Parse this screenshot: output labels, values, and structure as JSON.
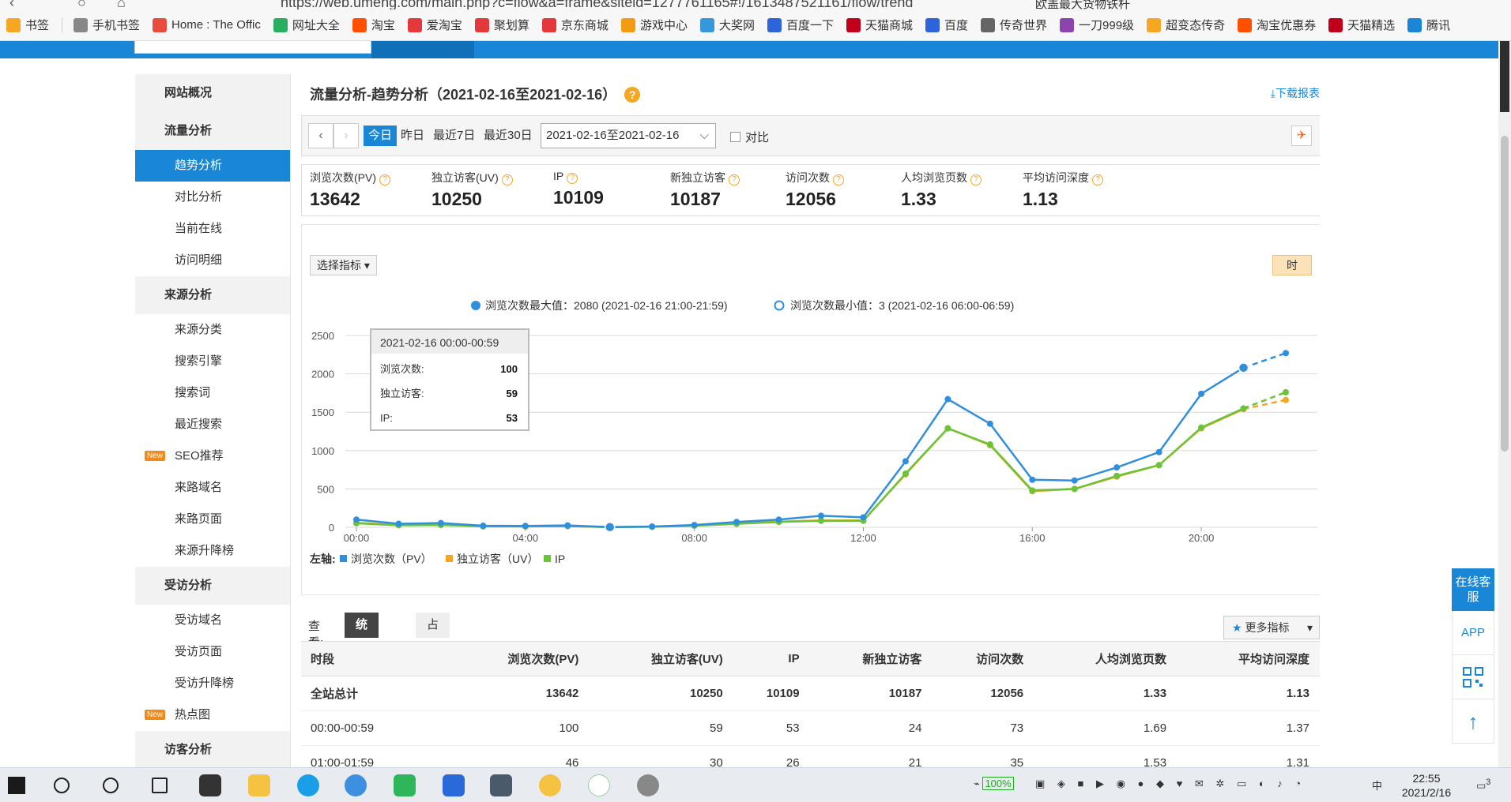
{
  "browser": {
    "url": "https://web.umeng.com/main.php?c=flow&a=frame&siteid=1277761165#!/1613487521161/flow/trend",
    "tab_title": "欧盖最大货物铁杆",
    "bookmarks": [
      {
        "label": "书签",
        "icon": "star-icon",
        "color": "#f5a623"
      },
      {
        "label": "手机书签",
        "icon": "phone-icon",
        "color": "#888888"
      },
      {
        "label": "Home : The Offic",
        "icon": "windows-icon",
        "color": "#e74c3c"
      },
      {
        "label": "网址大全",
        "icon": "hao-icon",
        "color": "#27ae60"
      },
      {
        "label": "淘宝",
        "icon": "taobao-icon",
        "color": "#ff5000"
      },
      {
        "label": "爱淘宝",
        "icon": "aitaobao-icon",
        "color": "#e4393c"
      },
      {
        "label": "聚划算",
        "icon": "juhuasuan-icon",
        "color": "#e4393c"
      },
      {
        "label": "京东商城",
        "icon": "jd-icon",
        "color": "#e4393c"
      },
      {
        "label": "游戏中心",
        "icon": "game-icon",
        "color": "#f39c12"
      },
      {
        "label": "大奖网",
        "icon": "award-icon",
        "color": "#3498db"
      },
      {
        "label": "百度一下",
        "icon": "baidu-icon",
        "color": "#2e64d9"
      },
      {
        "label": "天猫商城",
        "icon": "tmall-icon",
        "color": "#c0001a"
      },
      {
        "label": "百度",
        "icon": "baidu-icon",
        "color": "#2e64d9"
      },
      {
        "label": "传奇世界",
        "icon": "globe-icon",
        "color": "#666666"
      },
      {
        "label": "一刀999级",
        "icon": "game-icon",
        "color": "#8e44ad"
      },
      {
        "label": "超变态传奇",
        "icon": "smile-icon",
        "color": "#f5a623"
      },
      {
        "label": "淘宝优惠券",
        "icon": "taobao-icon",
        "color": "#ff5000"
      },
      {
        "label": "天猫精选",
        "icon": "tmall-icon",
        "color": "#c0001a"
      },
      {
        "label": "腾讯",
        "icon": "video-icon",
        "color": "#1a86d6"
      }
    ]
  },
  "sidebar": [
    {
      "type": "head",
      "label": "网站概况"
    },
    {
      "type": "head",
      "label": "流量分析"
    },
    {
      "type": "item",
      "label": "趋势分析",
      "active": true
    },
    {
      "type": "item",
      "label": "对比分析"
    },
    {
      "type": "item",
      "label": "当前在线"
    },
    {
      "type": "item",
      "label": "访问明细"
    },
    {
      "type": "head",
      "label": "来源分析"
    },
    {
      "type": "item",
      "label": "来源分类"
    },
    {
      "type": "item",
      "label": "搜索引擎"
    },
    {
      "type": "item",
      "label": "搜索词"
    },
    {
      "type": "item",
      "label": "最近搜索"
    },
    {
      "type": "item",
      "label": "SEO推荐",
      "badge": "New"
    },
    {
      "type": "item",
      "label": "来路域名"
    },
    {
      "type": "item",
      "label": "来路页面"
    },
    {
      "type": "item",
      "label": "来源升降榜"
    },
    {
      "type": "head",
      "label": "受访分析"
    },
    {
      "type": "item",
      "label": "受访域名"
    },
    {
      "type": "item",
      "label": "受访页面"
    },
    {
      "type": "item",
      "label": "受访升降榜"
    },
    {
      "type": "item",
      "label": "热点图",
      "badge": "New"
    },
    {
      "type": "head",
      "label": "访客分析"
    }
  ],
  "main": {
    "title": "流量分析-趋势分析（2021-02-16至2021-02-16）",
    "help": "?",
    "download": "下载报表",
    "filters": {
      "prev": "‹",
      "next": "›",
      "today": "今日",
      "yesterday": "昨日",
      "last7": "最近7日",
      "last30": "最近30日",
      "daterange": "2021-02-16至2021-02-16",
      "compare": "对比"
    },
    "metrics": [
      {
        "label": "浏览次数(PV)",
        "value": "13642"
      },
      {
        "label": "独立访客(UV)",
        "value": "10250"
      },
      {
        "label": "IP",
        "value": "10109"
      },
      {
        "label": "新独立访客",
        "value": "10187"
      },
      {
        "label": "访问次数",
        "value": "12056"
      },
      {
        "label": "人均浏览页数",
        "value": "1.33"
      },
      {
        "label": "平均访问深度",
        "value": "1.13"
      }
    ],
    "select_metric": "选择指标",
    "hour_button": "时",
    "view_label": "查看:",
    "view_tabs": [
      "统计报表",
      "占比"
    ],
    "more_metrics": "更多指标"
  },
  "chart_data": {
    "type": "line",
    "x": [
      "00:00",
      "01:00",
      "02:00",
      "03:00",
      "04:00",
      "05:00",
      "06:00",
      "07:00",
      "08:00",
      "09:00",
      "10:00",
      "11:00",
      "12:00",
      "13:00",
      "14:00",
      "15:00",
      "16:00",
      "17:00",
      "18:00",
      "19:00",
      "20:00",
      "21:00",
      "22:00"
    ],
    "xticks": [
      "00:00",
      "04:00",
      "08:00",
      "12:00",
      "16:00",
      "20:00"
    ],
    "ylim": [
      0,
      2500
    ],
    "yticks": [
      0,
      500,
      1000,
      1500,
      2000,
      2500
    ],
    "grid": true,
    "series": [
      {
        "name": "浏览次数（PV）",
        "color": "#2f8fdc",
        "values": [
          100,
          46,
          55,
          20,
          18,
          25,
          3,
          10,
          30,
          70,
          100,
          150,
          130,
          860,
          1670,
          1350,
          620,
          610,
          780,
          980,
          1740,
          2080,
          2270
        ],
        "dashed_from": 21
      },
      {
        "name": "独立访客（UV）",
        "color": "#f5a623",
        "values": [
          59,
          30,
          35,
          14,
          12,
          16,
          2,
          8,
          22,
          50,
          75,
          90,
          90,
          690,
          1290,
          1070,
          470,
          500,
          660,
          810,
          1290,
          1540,
          1660
        ],
        "dashed_from": 21
      },
      {
        "name": "IP",
        "color": "#6ac33a",
        "values": [
          53,
          26,
          30,
          12,
          11,
          15,
          2,
          7,
          20,
          45,
          70,
          85,
          85,
          700,
          1290,
          1080,
          480,
          500,
          670,
          810,
          1300,
          1550,
          1760
        ],
        "dashed_from": 21
      }
    ],
    "legend_top": {
      "max": "浏览次数最大值：2080 (2021-02-16 21:00-21:59)",
      "min": "浏览次数最小值：3 (2021-02-16 06:00-06:59)"
    },
    "legend_bottom_label": "左轴:",
    "legend_bottom": [
      "浏览次数（PV）",
      "独立访客（UV）",
      "IP"
    ],
    "tooltip": {
      "title": "2021-02-16 00:00-00:59",
      "rows": [
        {
          "label": "浏览次数:",
          "value": "100"
        },
        {
          "label": "独立访客:",
          "value": "59"
        },
        {
          "label": "IP:",
          "value": "53"
        }
      ]
    }
  },
  "table": {
    "headers": [
      "时段",
      "浏览次数(PV)",
      "独立访客(UV)",
      "IP",
      "新独立访客",
      "访问次数",
      "人均浏览页数",
      "平均访问深度"
    ],
    "rows": [
      {
        "total": true,
        "cells": [
          "全站总计",
          "13642",
          "10250",
          "10109",
          "10187",
          "12056",
          "1.33",
          "1.13"
        ]
      },
      {
        "cells": [
          "00:00-00:59",
          "100",
          "59",
          "53",
          "24",
          "73",
          "1.69",
          "1.37"
        ]
      },
      {
        "cells": [
          "01:00-01:59",
          "46",
          "30",
          "26",
          "21",
          "35",
          "1.53",
          "1.31"
        ]
      }
    ]
  },
  "float_panel": {
    "online": "在线客服",
    "app": "APP"
  },
  "taskbar": {
    "battery": "100%",
    "ime": "中",
    "time": "22:55",
    "date": "2021/2/16",
    "notifications": "3"
  }
}
